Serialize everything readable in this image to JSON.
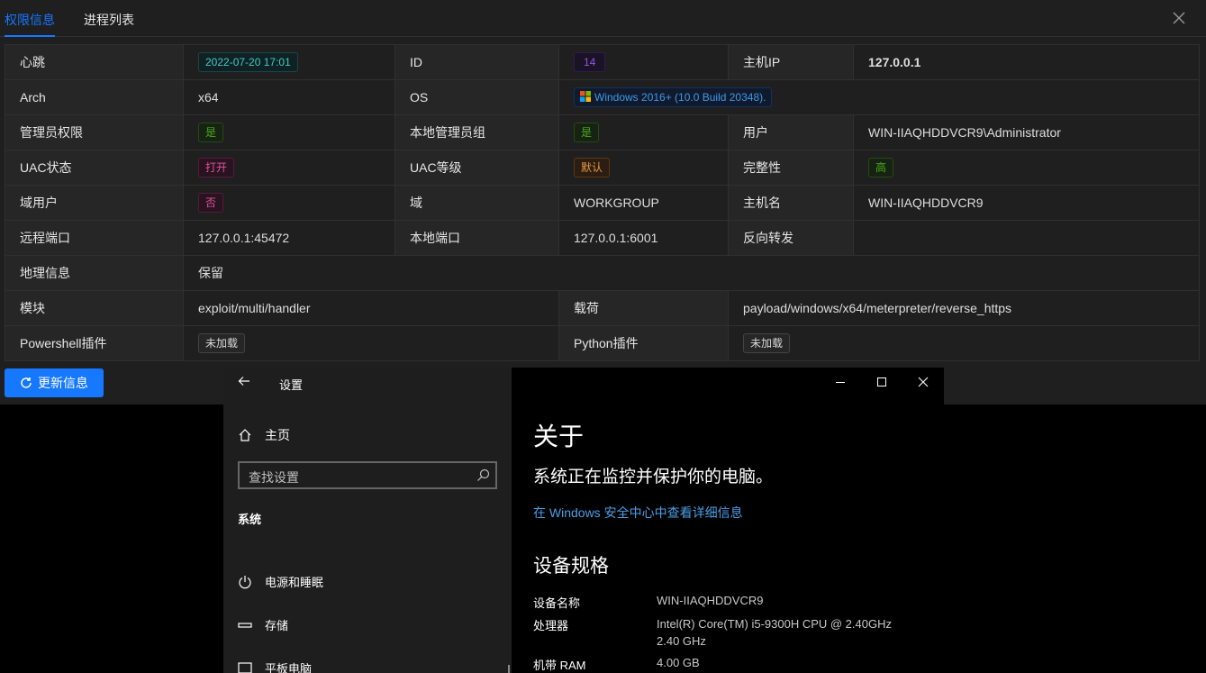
{
  "tabs": [
    "权限信息",
    "进程列表"
  ],
  "rows": {
    "r1": {
      "l1": "心跳",
      "v1": "2022-07-20 17:01",
      "l2": "ID",
      "v2": "14",
      "l3": "主机IP",
      "v3": "127.0.0.1"
    },
    "r2": {
      "l1": "Arch",
      "v1": "x64",
      "l2": "OS",
      "v2": "Windows 2016+ (10.0 Build 20348)."
    },
    "r3": {
      "l1": "管理员权限",
      "v1": "是",
      "l2": "本地管理员组",
      "v2": "是",
      "l3": "用户",
      "v3": "WIN-IIAQHDDVCR9\\Administrator"
    },
    "r4": {
      "l1": "UAC状态",
      "v1": "打开",
      "l2": "UAC等级",
      "v2": "默认",
      "l3": "完整性",
      "v3": "高"
    },
    "r5": {
      "l1": "域用户",
      "v1": "否",
      "l2": "域",
      "v2": "WORKGROUP",
      "l3": "主机名",
      "v3": "WIN-IIAQHDDVCR9"
    },
    "r6": {
      "l1": "远程端口",
      "v1": "127.0.0.1:45472",
      "l2": "本地端口",
      "v2": "127.0.0.1:6001",
      "l3": "反向转发",
      "v3": ""
    },
    "r7": {
      "l1": "地理信息",
      "v1": "保留"
    },
    "r8": {
      "l1": "模块",
      "v1": "exploit/multi/handler",
      "l2": "载荷",
      "v2": "payload/windows/x64/meterpreter/reverse_https"
    },
    "r9": {
      "l1": "Powershell插件",
      "v1": "未加载",
      "l2": "Python插件",
      "v2": "未加载"
    }
  },
  "refresh_label": "更新信息",
  "settings": {
    "title": "设置",
    "home": "主页",
    "search_placeholder": "查找设置",
    "section": "系统",
    "items": [
      "电源和睡眠",
      "存储",
      "平板电脑"
    ],
    "about_title": "关于",
    "monitor_text": "系统正在监控并保护你的电脑。",
    "security_link": "在 Windows 安全中心中查看详细信息",
    "spec_title": "设备规格",
    "specs": [
      {
        "k": "设备名称",
        "v": "WIN-IIAQHDDVCR9"
      },
      {
        "k": "处理器",
        "v": "Intel(R) Core(TM) i5-9300H CPU @ 2.40GHz",
        "v2": "2.40 GHz"
      },
      {
        "k": "机带 RAM",
        "v": "4.00 GB"
      }
    ]
  },
  "colors": {
    "accent": "#1677ff",
    "panel_bg": "#1f1f1f",
    "label_bg": "#262626",
    "ip_yellow": "#d8bd14"
  },
  "icons": [
    "close-icon",
    "windows-logo-icon",
    "refresh-icon",
    "back-arrow-icon",
    "home-icon",
    "search-icon",
    "power-icon",
    "storage-icon",
    "tablet-icon",
    "minimize-icon",
    "maximize-icon"
  ]
}
